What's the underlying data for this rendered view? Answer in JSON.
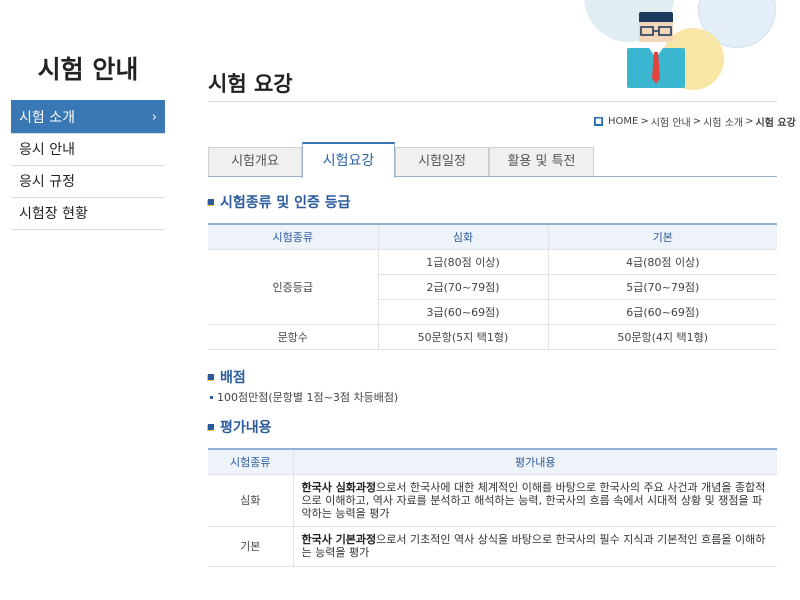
{
  "sidebar": {
    "title": "시험 안내",
    "items": [
      {
        "label": "시험 소개",
        "active": true
      },
      {
        "label": "응시 안내"
      },
      {
        "label": "응시 규정"
      },
      {
        "label": "시험장 현황"
      }
    ]
  },
  "page": {
    "title": "시험 요강"
  },
  "breadcrumb": {
    "items": [
      "HOME",
      "시험 안내",
      "시험 소개"
    ],
    "current": "시험 요강",
    "separator": ">"
  },
  "tabs": [
    {
      "label": "시험개요"
    },
    {
      "label": "시험요강",
      "active": true
    },
    {
      "label": "시험일정"
    },
    {
      "label": "활용 및 특전"
    }
  ],
  "section1": {
    "title": "시험종류 및 인증 등급",
    "headers": [
      "시험종류",
      "심화",
      "기본"
    ],
    "grade_label": "인증등급",
    "grades": [
      [
        "1급(80점 이상)",
        "4급(80점 이상)"
      ],
      [
        "2급(70~79점)",
        "5급(70~79점)"
      ],
      [
        "3급(60~69점)",
        "6급(60~69점)"
      ]
    ],
    "questions_label": "문항수",
    "questions": [
      "50문항(5지 택1형)",
      "50문항(4지 택1형)"
    ]
  },
  "section2": {
    "title": "배점",
    "bullet": "100점만점(문항별 1점~3점 차등배점)"
  },
  "section3": {
    "title": "평가내용",
    "headers": [
      "시험종류",
      "평가내용"
    ],
    "rows": [
      {
        "type": "심화",
        "bold": "한국사 심화과정",
        "text": "으로서 한국사에 대한 체계적인 이해를 바탕으로 한국사의 주요 사건과 개념을 종합적으로 이해하고, 역사 자료를 분석하고 해석하는 능력, 한국사의 흐름 속에서 시대적 상황 및 쟁점을 파악하는 능력을 평가"
      },
      {
        "type": "기본",
        "bold": "한국사 기본과정",
        "text": "으로서 기초적인 역사 상식을 바탕으로 한국사의 필수 지식과 기본적인 흐름을 이해하는 능력을 평가"
      }
    ]
  },
  "colors": {
    "accent": "#3a77b5",
    "heading": "#2b5b9c",
    "table_header_bg": "#edf3f9"
  }
}
